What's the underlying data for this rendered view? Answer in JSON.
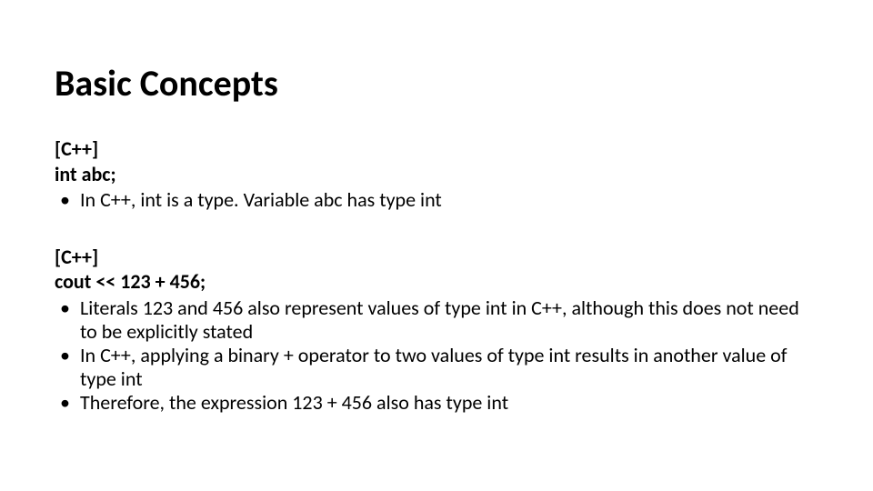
{
  "title": "Basic Concepts",
  "section1": {
    "tag": "[C++]",
    "code": "int abc;",
    "bullets": [
      "In C++, int is a type. Variable abc has type int"
    ]
  },
  "section2": {
    "tag": "[C++]",
    "code": "cout << 123 + 456;",
    "bullets": [
      "Literals 123 and 456 also represent values of type int in C++, although this does not need to be explicitly stated",
      "In C++, applying a binary + operator to two values of type int results in another value of type int",
      "Therefore, the expression 123 + 456 also has type int"
    ]
  }
}
